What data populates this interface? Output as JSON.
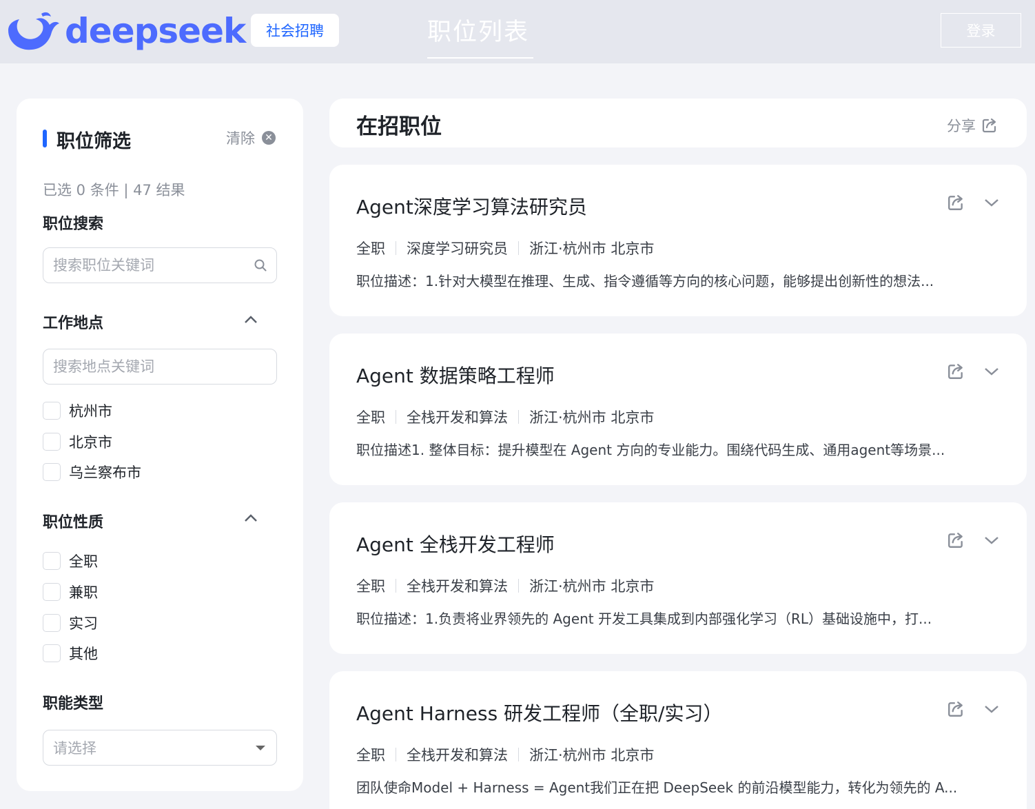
{
  "header": {
    "logo_text": "deepseek",
    "recruit_badge": "社会招聘",
    "nav_title": "职位列表",
    "login_label": "登录"
  },
  "sidebar": {
    "title": "职位筛选",
    "clear_label": "清除",
    "summary": "已选 0 条件 | 47 结果",
    "search_label": "职位搜索",
    "search_placeholder": "搜索职位关键词",
    "location_label": "工作地点",
    "location_placeholder": "搜索地点关键词",
    "locations": [
      "杭州市",
      "北京市",
      "乌兰察布市"
    ],
    "nature_label": "职位性质",
    "natures": [
      "全职",
      "兼职",
      "实习",
      "其他"
    ],
    "function_label": "职能类型",
    "function_placeholder": "请选择"
  },
  "main": {
    "title": "在招职位",
    "share_label": "分享",
    "jobs": [
      {
        "title": "Agent深度学习算法研究员",
        "type": "全职",
        "category": "深度学习研究员",
        "location": "浙江·杭州市 北京市",
        "desc": "职位描述：1.针对大模型在推理、生成、指令遵循等方向的核心问题，能够提出创新性的想法..."
      },
      {
        "title": "Agent 数据策略工程师",
        "type": "全职",
        "category": "全栈开发和算法",
        "location": "浙江·杭州市 北京市",
        "desc": "职位描述1. 整体目标：提升模型在 Agent 方向的专业能力。围绕代码生成、通用agent等场景..."
      },
      {
        "title": "Agent 全栈开发工程师",
        "type": "全职",
        "category": "全栈开发和算法",
        "location": "浙江·杭州市 北京市",
        "desc": "职位描述：1.负责将业界领先的 Agent 开发工具集成到内部强化学习（RL）基础设施中，打..."
      },
      {
        "title": "Agent Harness 研发工程师（全职/实习）",
        "type": "全职",
        "category": "全栈开发和算法",
        "location": "浙江·杭州市 北京市",
        "desc": "团队使命Model + Harness = Agent我们正在把 DeepSeek 的前沿模型能力，转化为领先的 A..."
      }
    ]
  },
  "colors": {
    "accent": "#1f66ff",
    "brand": "#4d6bfe"
  }
}
